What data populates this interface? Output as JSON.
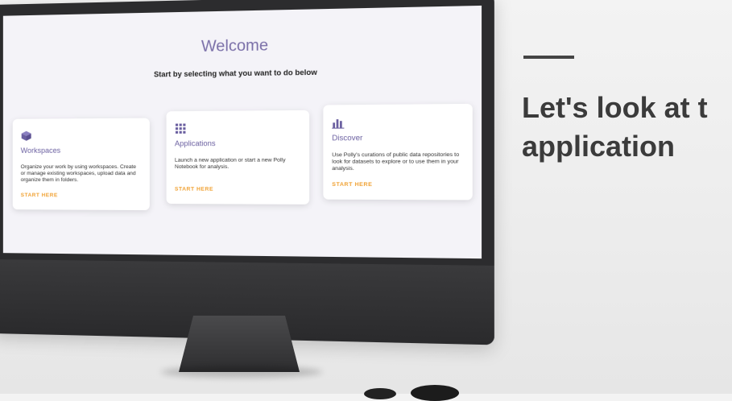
{
  "screen": {
    "title": "Welcome",
    "subtitle": "Start by selecting what you want to do below",
    "cards": [
      {
        "title": "Workspaces",
        "icon": "cube-icon",
        "description": "Organize your work by using workspaces. Create or manage existing workspaces, upload data and organize them in folders.",
        "cta": "START HERE"
      },
      {
        "title": "Applications",
        "icon": "grid-icon",
        "description": "Launch a new application or start a new Polly Notebook for analysis.",
        "cta": "START HERE"
      },
      {
        "title": "Discover",
        "icon": "bar-chart-icon",
        "description": "Use Polly's curations of public data repositories to look for datasets to explore or to use them in your analysis.",
        "cta": "START HERE"
      }
    ]
  },
  "overlay": {
    "line1": "Let's look at t",
    "line2": "application"
  },
  "colors": {
    "accent": "#7a6fa8",
    "cta": "#f0a030",
    "headline": "#3b3b3b"
  }
}
